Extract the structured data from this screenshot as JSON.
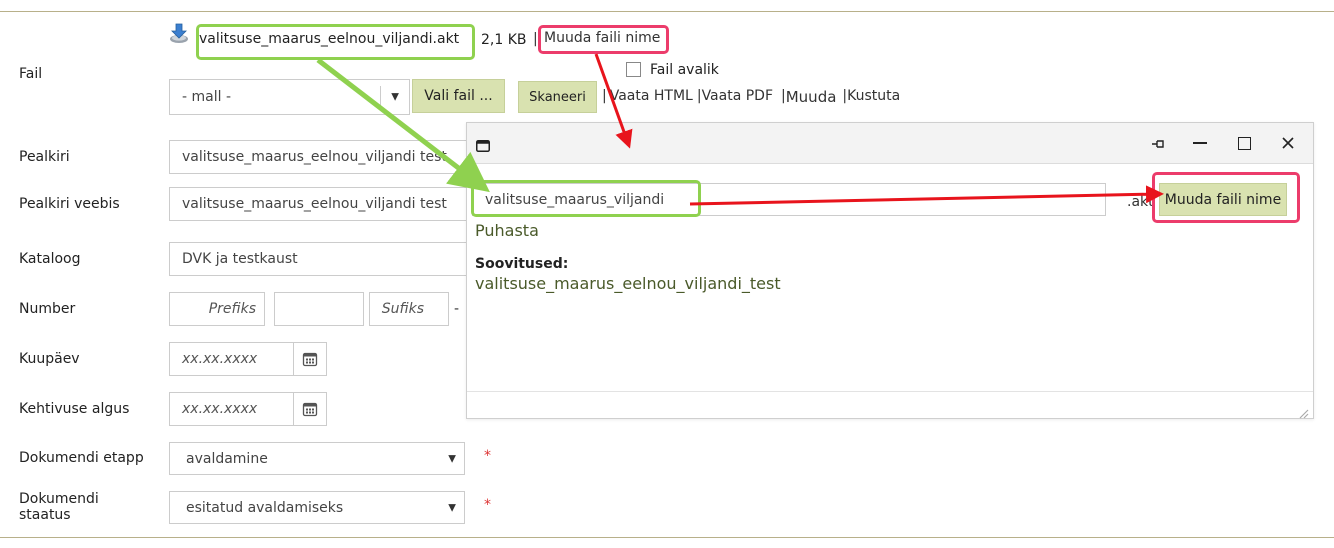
{
  "file": {
    "label": "Fail",
    "name": "valitsuse_maarus_eelnou_viljandi.akt",
    "size": "2,1 KB",
    "separator": "|",
    "rename_link": "Muuda faili nime",
    "public_checkbox_label": "Fail avalik",
    "template_select_value": "- mall -",
    "choose_button": "Vali fail ...",
    "scan_button": "Skaneeri",
    "actions": {
      "sep1": "|",
      "view_html": "Vaata HTML",
      "sep2": "|",
      "view_pdf": "Vaata PDF",
      "sep3": "|",
      "edit": "Muuda",
      "sep4": "|",
      "delete": "Kustuta"
    }
  },
  "form": {
    "title_label": "Pealkiri",
    "title_value": "valitsuse_maarus_eelnou_viljandi test",
    "web_title_label": "Pealkiri veebis",
    "web_title_value": "valitsuse_maarus_eelnou_viljandi test",
    "catalog_label": "Kataloog",
    "catalog_value": "DVK ja testkaust",
    "number_label": "Number",
    "number_prefix_placeholder": "Prefiks",
    "number_value": "",
    "number_suffix_placeholder": "Sufiks",
    "number_dash": "-",
    "date_label": "Kuupäev",
    "date_placeholder": "xx.xx.xxxx",
    "valid_from_label": "Kehtivuse algus",
    "valid_from_placeholder": "xx.xx.xxxx",
    "stage_label": "Dokumendi etapp",
    "stage_value": "avaldamine",
    "status_label_line1": "Dokumendi",
    "status_label_line2": "staatus",
    "status_value": "esitatud avaldamiseks",
    "required_mark": "*"
  },
  "dialog": {
    "filename_value": "valitsuse_maarus_viljandi",
    "extension": ".akt",
    "rename_button": "Muuda faili nime",
    "clear_link": "Puhasta",
    "suggestions_label": "Soovitused:",
    "suggestion": "valitsuse_maarus_eelnou_viljandi_test"
  },
  "colors": {
    "button_green": "#d9e2b0",
    "highlight_green": "#8fd14f",
    "highlight_pink": "#ec3c6b",
    "arrow_green": "#8fd14f",
    "arrow_red": "#e8141c",
    "required": "#dd3333"
  }
}
